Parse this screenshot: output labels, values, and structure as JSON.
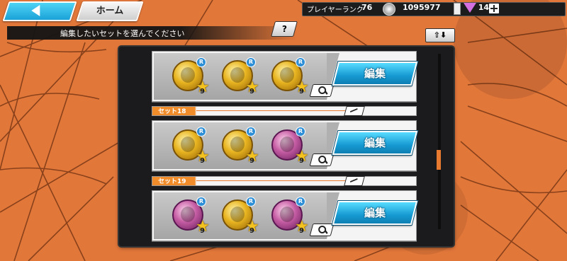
{
  "header": {
    "home_label": "ホーム",
    "player_rank_label": "プレイヤーランク",
    "player_rank_value": "76",
    "coins": "1095977",
    "gems": "14"
  },
  "instruction": "編集したいセットを選んでください",
  "help_label": "?",
  "sort_label": "⇧⬇",
  "edit_label": "編集",
  "sets": [
    {
      "label": "",
      "medals": [
        "gold",
        "gold",
        "gold"
      ],
      "levels": [
        "9",
        "9",
        "9"
      ]
    },
    {
      "label": "セット18",
      "medals": [
        "gold",
        "gold",
        "pink"
      ],
      "levels": [
        "9",
        "9",
        "9"
      ]
    },
    {
      "label": "セット19",
      "medals": [
        "pink",
        "gold",
        "pink"
      ],
      "levels": [
        "9",
        "9",
        "9"
      ]
    }
  ],
  "colors": {
    "accent": "#1aa2d8",
    "tab_orange": "#f08c2a",
    "background": "#e2773a"
  }
}
